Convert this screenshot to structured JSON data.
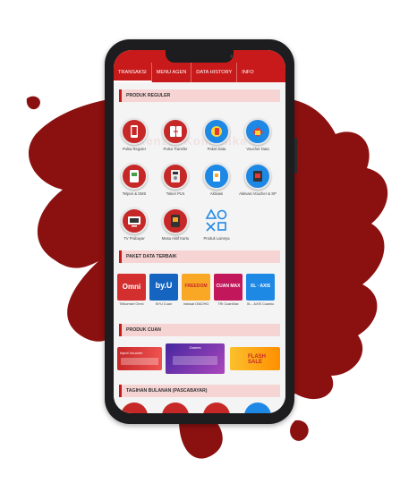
{
  "tabs": [
    {
      "label": "TRANSAKSI",
      "active": true
    },
    {
      "label": "MENU AGEN",
      "active": false
    },
    {
      "label": "DATA HISTORY",
      "active": false
    },
    {
      "label": "INFO",
      "active": false
    }
  ],
  "watermark": "Kenzie Komunika",
  "sections": {
    "produk_reguler": "PRODUK REGULER",
    "paket_data": "PAKET DATA TERBAIK",
    "produk_cuan": "PRODUK CUAN",
    "tagihan": "TAGIHAN BULANAN (PASCABAYAR)"
  },
  "reguler_items": [
    {
      "label": "Pulsa Reguler",
      "icon": "phone-icon"
    },
    {
      "label": "Pulsa Transfer",
      "icon": "phone-transfer-icon"
    },
    {
      "label": "Paket Data",
      "icon": "data-package-icon"
    },
    {
      "label": "Voucher Data",
      "icon": "voucher-icon"
    },
    {
      "label": "Telpon & SMS",
      "icon": "sms-phone-icon"
    },
    {
      "label": "Token PLN",
      "icon": "electricity-token-icon"
    },
    {
      "label": "Aktivasi",
      "icon": "sim-activation-icon"
    },
    {
      "label": "Aktivasi Voucher & SP",
      "icon": "voucher-activation-icon"
    },
    {
      "label": "TV Prabayar",
      "icon": "tv-icon"
    },
    {
      "label": "Masa Aktif Kartu",
      "icon": "sim-card-icon"
    },
    {
      "label": "Produk Lainnya",
      "icon": "more-products-icon"
    }
  ],
  "paket_cards": [
    {
      "label": "Telkomsel Omni",
      "brand": "Omni",
      "color": "#d32f2f"
    },
    {
      "label": "BYU Cuan",
      "brand": "by.U",
      "color": "#1565c0"
    },
    {
      "label": "Indosat OMZ/HG",
      "brand": "FREEDOM",
      "color": "#f9a825"
    },
    {
      "label": "TRI CuanMax",
      "brand": "CUAN MAX",
      "color": "#c2185b"
    },
    {
      "label": "XL - AXIS Cuanku",
      "brand": "XL · AXIS",
      "color": "#1e88e5"
    }
  ],
  "cuan_banners": [
    {
      "label": "Inject Voucher",
      "color": "#c62828"
    },
    {
      "label": "Games",
      "color": "#5e35b1"
    },
    {
      "label": "FLASH SALE",
      "color": "#fbc02d"
    }
  ],
  "colors": {
    "brand": "#c81a1a",
    "splat": "#8b1010",
    "tabbar": "#c81a1a"
  }
}
